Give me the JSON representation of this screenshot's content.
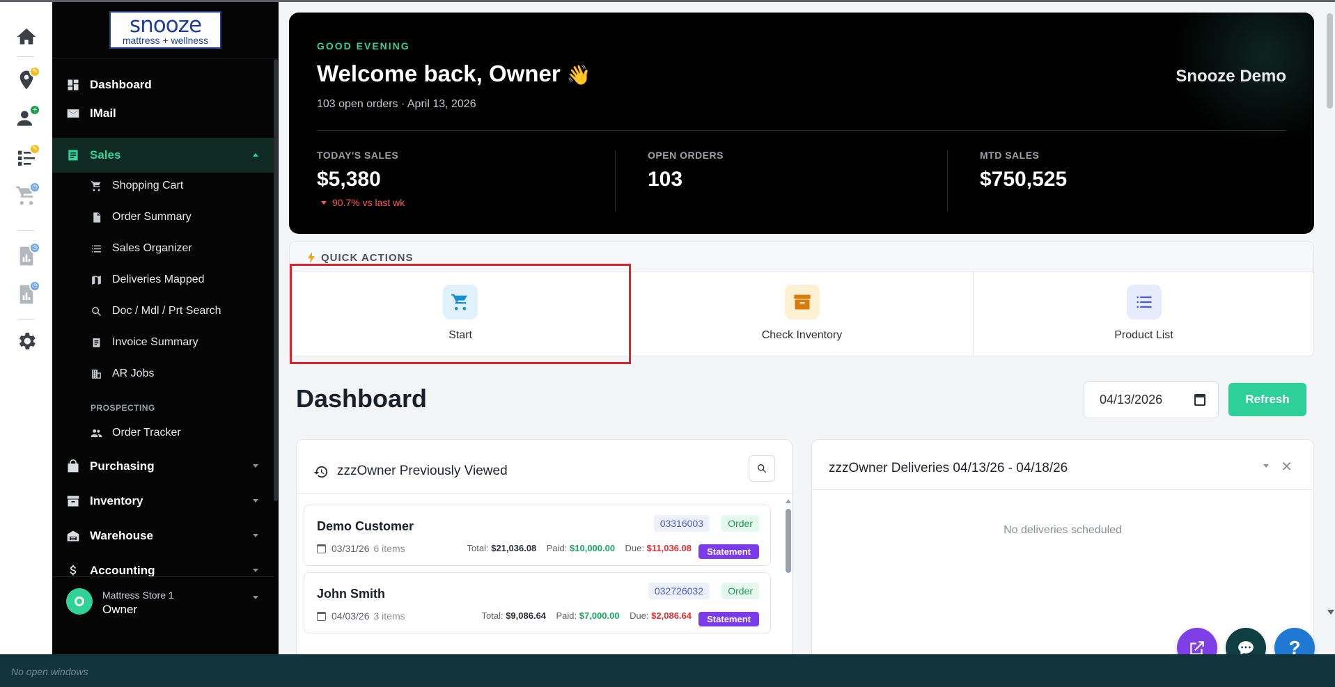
{
  "brand": {
    "name": "snooze",
    "tagline": "mattress + wellness",
    "color": "#1e3f94"
  },
  "rail": [
    {
      "icon": "home-icon"
    },
    {
      "icon": "location-pin-icon",
      "badge_color": "#f2c01e"
    },
    {
      "icon": "add-user-icon",
      "badge_color": "#1f9d55"
    },
    {
      "icon": "checklist-icon",
      "badge_color": "#f2c01e"
    },
    {
      "icon": "cart-icon",
      "badge_color": "#6ea6e8"
    },
    {
      "icon": "report-icon",
      "badge_color": "#6ea6e8"
    },
    {
      "icon": "report-icon",
      "badge_color": "#6ea6e8"
    },
    {
      "icon": "gear-icon"
    }
  ],
  "sidebar": {
    "main": [
      {
        "label": "Dashboard",
        "icon": "dashboard-icon"
      },
      {
        "label": "IMail",
        "icon": "mail-icon"
      },
      {
        "label": "Sales",
        "icon": "sales-icon",
        "active": true
      }
    ],
    "sales_sub": [
      {
        "label": "Shopping Cart",
        "icon": "cart-icon"
      },
      {
        "label": "Order Summary",
        "icon": "document-icon"
      },
      {
        "label": "Sales Organizer",
        "icon": "list-icon"
      },
      {
        "label": "Deliveries Mapped",
        "icon": "map-icon"
      },
      {
        "label": "Doc / Mdl / Prt Search",
        "icon": "search-icon"
      },
      {
        "label": "Invoice Summary",
        "icon": "receipt-icon"
      },
      {
        "label": "AR Jobs",
        "icon": "building-icon"
      }
    ],
    "section_label": "PROSPECTING",
    "prospecting": [
      {
        "label": "Order Tracker",
        "icon": "people-icon"
      }
    ],
    "groups": [
      {
        "label": "Purchasing",
        "icon": "bag-icon"
      },
      {
        "label": "Inventory",
        "icon": "archive-icon"
      },
      {
        "label": "Warehouse",
        "icon": "warehouse-icon"
      },
      {
        "label": "Accounting",
        "icon": "dollar-icon"
      }
    ],
    "store": {
      "name": "Mattress Store 1",
      "role": "Owner",
      "avatar_color": "#2fd39a"
    }
  },
  "hero": {
    "greeting": "GOOD EVENING",
    "welcome": "Welcome back, Owner",
    "wave": "👋",
    "subtitle": "103 open orders · April 13, 2026",
    "company": "Snooze Demo",
    "kpis": [
      {
        "label": "TODAY'S SALES",
        "value": "$5,380",
        "delta": "90.7% vs last wk"
      },
      {
        "label": "OPEN ORDERS",
        "value": "103",
        "delta": ""
      },
      {
        "label": "MTD SALES",
        "value": "$750,525",
        "delta": ""
      }
    ]
  },
  "quick_actions": {
    "title": "QUICK ACTIONS",
    "items": [
      {
        "label": "Start",
        "icon": "cart-icon",
        "bg": "#e1f1fb",
        "fg": "#1a8fd6"
      },
      {
        "label": "Check Inventory",
        "icon": "archive-icon",
        "bg": "#fdf1d3",
        "fg": "#d97b0b"
      },
      {
        "label": "Product List",
        "icon": "list-icon",
        "bg": "#e8ebfb",
        "fg": "#4b5bd6"
      }
    ]
  },
  "dashboard": {
    "title": "Dashboard",
    "date_value": "04/13/2026",
    "refresh_label": "Refresh"
  },
  "previously_viewed": {
    "title": "zzzOwner Previously Viewed",
    "orders": [
      {
        "customer": "Demo Customer",
        "order_no": "03316003",
        "status": "Order",
        "date": "03/31/26",
        "items": "6 items",
        "total_label": "Total:",
        "total": "$21,036.08",
        "paid_label": "Paid:",
        "paid": "$10,000.00",
        "due_label": "Due:",
        "due": "$11,036.08",
        "statement_label": "Statement"
      },
      {
        "customer": "John Smith",
        "order_no": "032726032",
        "status": "Order",
        "date": "04/03/26",
        "items": "3 items",
        "total_label": "Total:",
        "total": "$9,086.64",
        "paid_label": "Paid:",
        "paid": "$7,000.00",
        "due_label": "Due:",
        "due": "$2,086.64",
        "statement_label": "Statement"
      }
    ]
  },
  "deliveries": {
    "title": "zzzOwner Deliveries 04/13/26 - 04/18/26",
    "close": "✕",
    "empty_text": "No deliveries scheduled"
  },
  "taskbar": {
    "text": "No open windows"
  },
  "fabs": [
    {
      "icon": "external-link-icon",
      "color": "#7e3fe6"
    },
    {
      "icon": "chat-icon",
      "color": "#0f3e43"
    },
    {
      "icon": "help-icon",
      "label": "?",
      "color": "#1f78d1"
    }
  ]
}
